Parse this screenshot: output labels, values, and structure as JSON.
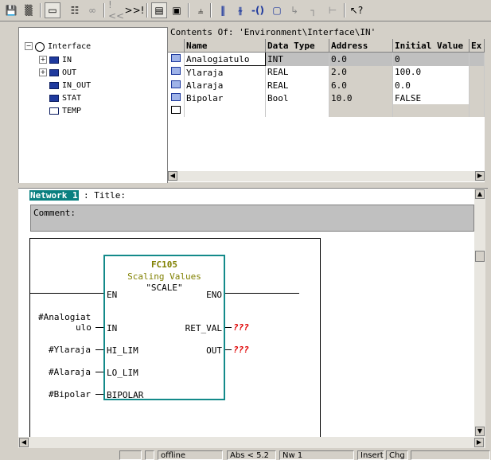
{
  "toolbar": {
    "buttons": [
      "save-icon",
      "tree-icon",
      "open-icon",
      "network-icon",
      "link-icon",
      "prev-network-icon",
      "next-network-icon",
      "view-lad-icon",
      "view-fbd-icon",
      "toggle-icon",
      "normally-open-contact-icon",
      "normally-closed-contact-icon",
      "coil-icon",
      "box-icon",
      "branch-open-icon",
      "branch-close-icon",
      "connect-icon",
      "help-icon"
    ],
    "prev_label": "!<<",
    "next_label": ">>!"
  },
  "tree": {
    "root": "Interface",
    "items": [
      "IN",
      "OUT",
      "IN_OUT",
      "STAT",
      "TEMP"
    ]
  },
  "contents_header": "Contents Of: 'Environment\\Interface\\IN'",
  "table": {
    "columns": [
      "Name",
      "Data Type",
      "Address",
      "Initial Value",
      "Ex"
    ],
    "rows": [
      {
        "name": "Analogiatulo",
        "type": "INT",
        "address": "0.0",
        "initial": "0"
      },
      {
        "name": "Ylaraja",
        "type": "REAL",
        "address": "2.0",
        "initial": "100.0"
      },
      {
        "name": "Alaraja",
        "type": "REAL",
        "address": "6.0",
        "initial": "0.0"
      },
      {
        "name": "Bipolar",
        "type": "Bool",
        "address": "10.0",
        "initial": "FALSE"
      }
    ]
  },
  "network": {
    "label": "Network 1",
    "title": ": Title:",
    "comment": "Comment:"
  },
  "block": {
    "name": "FC105",
    "description": "Scaling Values",
    "symbol": "\"SCALE\"",
    "in_pins": [
      "EN",
      "IN",
      "HI_LIM",
      "LO_LIM",
      "BIPOLAR"
    ],
    "out_pins": [
      "ENO",
      "RET_VAL",
      "OUT"
    ],
    "inputs": [
      "#Analogiat",
      "ulo",
      "#Ylaraja",
      "#Alaraja",
      "#Bipolar"
    ],
    "outputs": [
      "???",
      "???"
    ]
  },
  "status": [
    "offline",
    "Abs < 5.2",
    "Nw 1",
    "Insert",
    "Chg"
  ]
}
